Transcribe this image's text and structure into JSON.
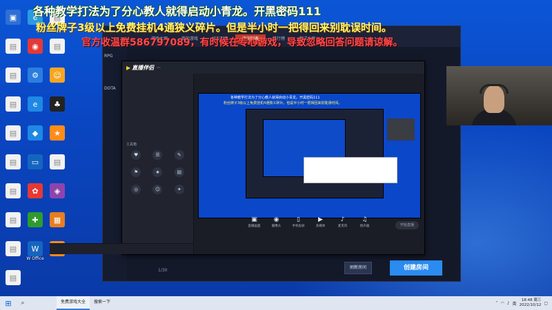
{
  "banners": {
    "line1": "各种教学打法为了分心教人就得启动小青龙。开黑密码111",
    "line2": "粉丝牌子3级以上免费挂机4通狭义碎片。但是半小时一把得回来别耽误时间。",
    "line3": "官方收温群586797089，有时候在专心游戏，导致忽略回答问题请谅解。"
  },
  "desktop_icons": [
    {
      "label": "",
      "color": "#2f6fd6",
      "glyph": "▣"
    },
    {
      "label": "",
      "color": "#2b9be0",
      "glyph": "e"
    },
    {
      "label": "",
      "color": "#f2f2f2",
      "glyph": "▤"
    },
    {
      "label": "",
      "color": "#f2f2f2",
      "glyph": "▤"
    },
    {
      "label": "",
      "color": "#e53935",
      "glyph": "◉"
    },
    {
      "label": "",
      "color": "#f2f2f2",
      "glyph": "▤"
    },
    {
      "label": "",
      "color": "#f2f2f2",
      "glyph": "▤"
    },
    {
      "label": "",
      "color": "#2b7de0",
      "glyph": "⚙"
    },
    {
      "label": "",
      "color": "#f5a623",
      "glyph": "☺"
    },
    {
      "label": "",
      "color": "#f2f2f2",
      "glyph": "▤"
    },
    {
      "label": "",
      "color": "#1e88e5",
      "glyph": "e"
    },
    {
      "label": "",
      "color": "#222222",
      "glyph": "♣"
    },
    {
      "label": "",
      "color": "#f2f2f2",
      "glyph": "▤"
    },
    {
      "label": "",
      "color": "#1e88e5",
      "glyph": "◆"
    },
    {
      "label": "",
      "color": "#ff8c1a",
      "glyph": "★"
    },
    {
      "label": "",
      "color": "#f2f2f2",
      "glyph": "▤"
    },
    {
      "label": "",
      "color": "#1565c0",
      "glyph": "▭"
    },
    {
      "label": "",
      "color": "#f2f2f2",
      "glyph": "▤"
    },
    {
      "label": "",
      "color": "#f2f2f2",
      "glyph": "▤"
    },
    {
      "label": "",
      "color": "#e53935",
      "glyph": "✿"
    },
    {
      "label": "",
      "color": "#8e44ad",
      "glyph": "◈"
    },
    {
      "label": "",
      "color": "#f2f2f2",
      "glyph": "▤"
    },
    {
      "label": "",
      "color": "#2e9b2e",
      "glyph": "✚"
    },
    {
      "label": "",
      "color": "#e67e22",
      "glyph": "▦"
    },
    {
      "label": "",
      "color": "#f2f2f2",
      "glyph": "▤"
    },
    {
      "label": "W Office",
      "color": "#1565c0",
      "glyph": "W"
    },
    {
      "label": "",
      "color": "#ff8c1a",
      "glyph": "★"
    },
    {
      "label": "",
      "color": "#f2f2f2",
      "glyph": "▤"
    }
  ],
  "game_window": {
    "tabs": [
      "游戏大厅",
      "我的游戏",
      "好友列表",
      "房间列表",
      "排行榜",
      "测试大厅"
    ],
    "active_tab_index": 3,
    "side_items": [
      "RPG",
      "",
      "DOTA"
    ],
    "refresh_label": "刷新房间",
    "create_label": "创建房间",
    "pager": "1/30"
  },
  "live_app": {
    "logo": "直播伴侣",
    "badge": "",
    "left_tabs": [
      "",
      "",
      ""
    ],
    "scenes": [
      "",
      "",
      "",
      "",
      "",
      "",
      ""
    ],
    "tool_section_title": "工具箱",
    "tools": [
      {
        "label": "",
        "glyph": "♥"
      },
      {
        "label": "",
        "glyph": "☰"
      },
      {
        "label": "",
        "glyph": "✎"
      },
      {
        "label": "",
        "glyph": "⚑"
      },
      {
        "label": "",
        "glyph": "★"
      },
      {
        "label": "",
        "glyph": "▤"
      },
      {
        "label": "",
        "glyph": "◎"
      },
      {
        "label": "",
        "glyph": "☺"
      },
      {
        "label": "",
        "glyph": "✦"
      }
    ],
    "room_title": "",
    "room_meta": "",
    "preview_banner1": "各种教学打法为了分心教人就得启动小青龙。开黑密码111",
    "preview_banner2": "粉丝牌子3级以上免费挂机4通狭义碎片。但是半小时一把得回来别耽误时间。",
    "preview_tooltip": "",
    "controls": [
      {
        "label": "直播画面",
        "glyph": "▣"
      },
      {
        "label": "摄像头",
        "glyph": "◉"
      },
      {
        "label": "手机投屏",
        "glyph": "▯"
      },
      {
        "label": "多媒体",
        "glyph": "▶"
      },
      {
        "label": "麦克风",
        "glyph": "♪"
      },
      {
        "label": "扬声器",
        "glyph": "♫"
      }
    ],
    "go_live": "开始直播",
    "status": "",
    "footer": ""
  },
  "taskbar": {
    "app_label": "免费游戏大全",
    "app2_label": "搜索一下",
    "tray_text": "英",
    "time": "18:48 周三",
    "date": "2022/10/12"
  }
}
